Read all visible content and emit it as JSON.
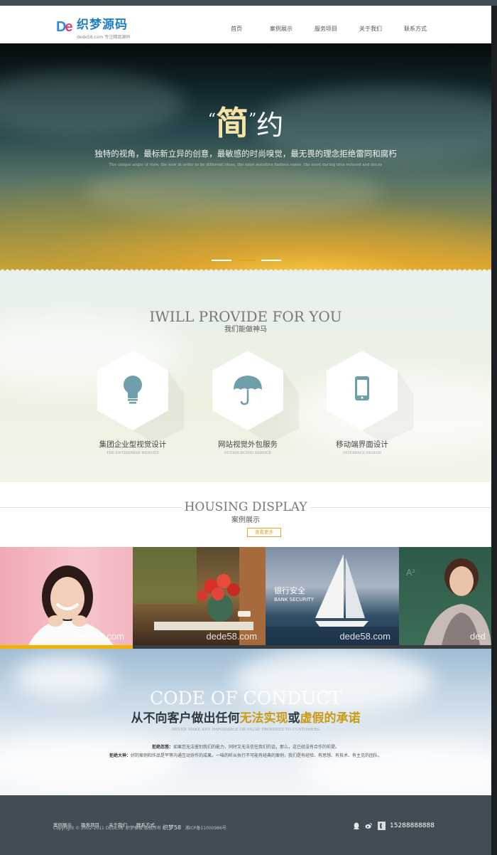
{
  "header": {
    "logo_mark": "De",
    "logo_title": "织梦源码",
    "logo_domain": "dede58.com",
    "logo_slogan": "专注精品源码",
    "nav": [
      "首页",
      "案例展示",
      "服务项目",
      "关于我们",
      "联系方式"
    ]
  },
  "hero": {
    "title_open_quote": "“",
    "title_char1": "简",
    "title_close_quote": "”",
    "title_char2": "约",
    "subtitle": "独特的视角，最标新立异的创意，最敏感的时尚嗅觉，最无畏的理念拒绝雷同和腐朽",
    "subtitle_en": "The unique angle of view, the new in order to be different ideas, the most sensitive fashion sense, the most daring idea refused and decay",
    "active_slide": 2,
    "slide_count": 3
  },
  "services": {
    "title": "IWILL PROVIDE FOR YOU",
    "subtitle": "我们能做神马",
    "items": [
      {
        "icon": "lightbulb-icon",
        "name": "集团企业型视觉设计",
        "en": "THE ENTERPRISE WEBSITE"
      },
      {
        "icon": "umbrella-icon",
        "name": "网站视觉外包服务",
        "en": "OUTSOURCING SERVICE"
      },
      {
        "icon": "mobile-phone-icon",
        "name": "移动端界面设计",
        "en": "INTERFACE DESIGN"
      }
    ]
  },
  "housing": {
    "title": "HOUSING DISPLAY",
    "subtitle": "案例展示",
    "more_label": "查看更多",
    "tiles": [
      {
        "alt": "smiling woman portrait",
        "watermark": "dede58.com",
        "overlay_text": ""
      },
      {
        "alt": "red roses in vase",
        "watermark": "dede58.com",
        "overlay_text": ""
      },
      {
        "alt": "sailboat at sea",
        "watermark": "dede58.com",
        "overlay_text": "银行安全"
      },
      {
        "alt": "teacher at chalkboard",
        "watermark": "ded",
        "overlay_text": ""
      }
    ],
    "tile2_overlay_en": "BANK SECURITY"
  },
  "conduct": {
    "title": "CODE OF CONDUCT",
    "slogan_a": "从不向客户做出任何",
    "slogan_hl1": "无法实现",
    "slogan_b": "或",
    "slogan_hl2": "虚假的承诺",
    "slogan_en": "NEVER MAKE ANY IMPOSSIBLE OR FALSE PROMISES TO CUSTOMERS",
    "line1_label": "拒绝忽悠：",
    "line1_text": "如果您无法鉴别我们的能力，同时又无法信任我们的话，那么，这已经没有合作的前提。",
    "line2_label": "拒绝大神：",
    "line2_text": "好的案例和作品是平等沟通互动协作的成果。一味的听从执行不可能有经典的案例，我们是有经验、有思想、有技术、有主见的团队。"
  },
  "footer": {
    "links": [
      "案例展示",
      "服务项目",
      "关于我们",
      "联系方式"
    ],
    "copyright": "Copyright © 2002-2011 DEDE58. 织梦模板 版权所有",
    "brand": "织梦58",
    "icp": "湘ICP备11000986号",
    "phone": "15288888888"
  },
  "colors": {
    "accent": "#e9a514",
    "footer_bg": "#404d54",
    "hex_icon": "#6e9fab"
  }
}
